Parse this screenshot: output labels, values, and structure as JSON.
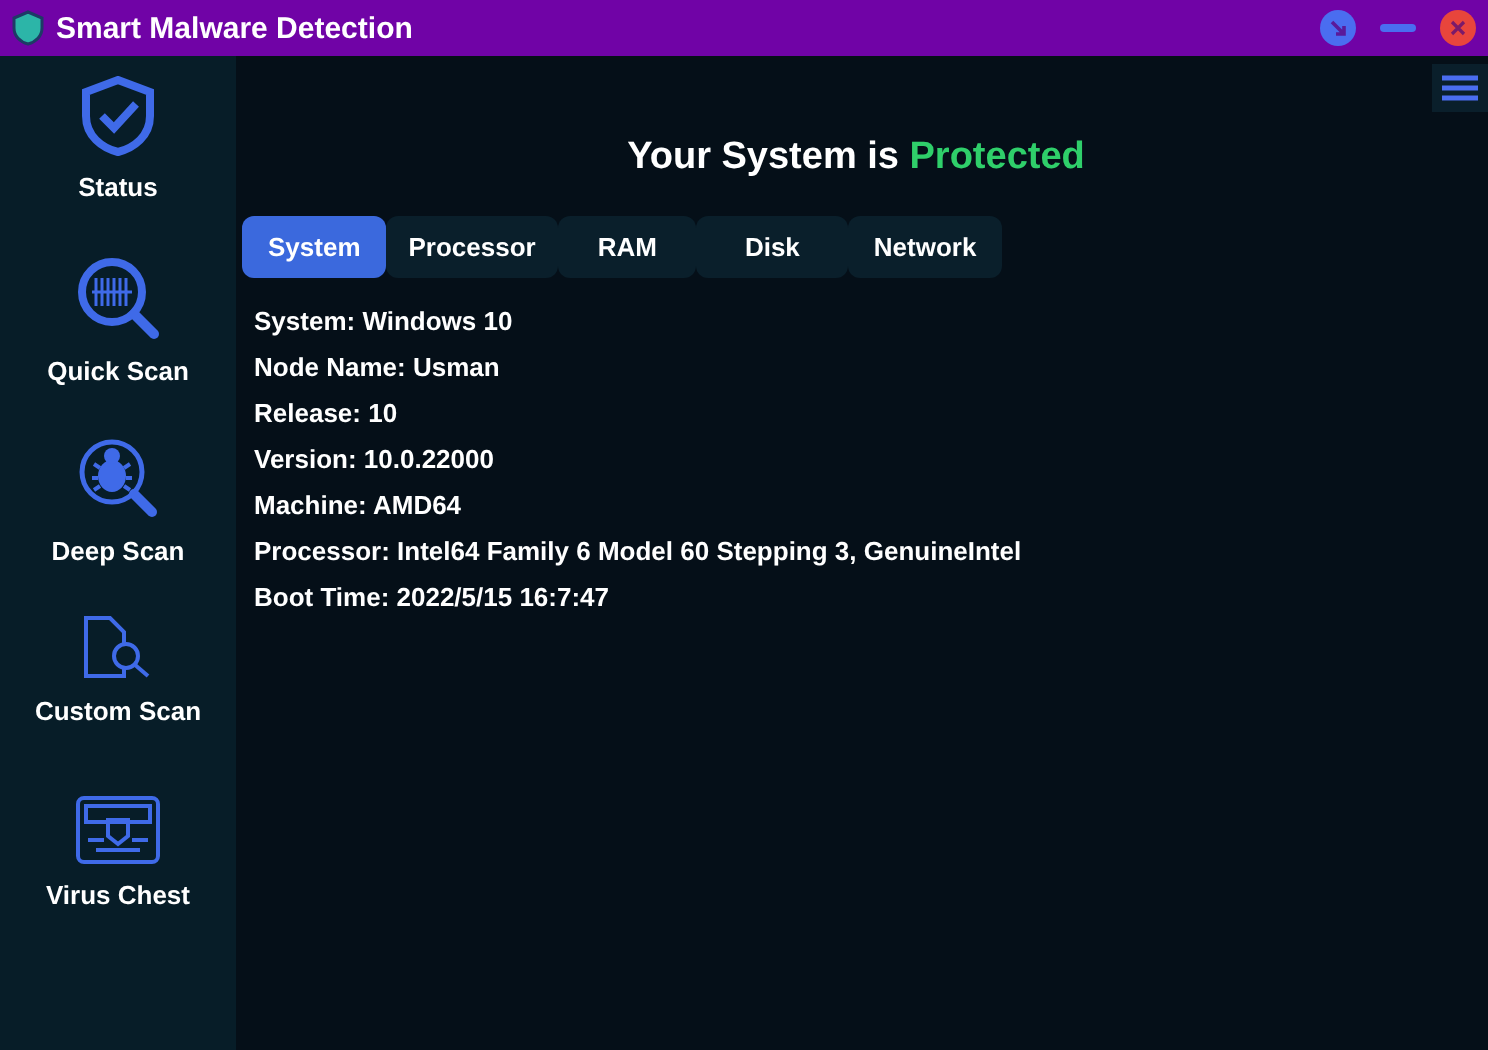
{
  "window": {
    "title": "Smart Malware Detection"
  },
  "sidebar": {
    "items": [
      {
        "label": "Status",
        "kind": "shield"
      },
      {
        "label": "Quick Scan",
        "kind": "quick"
      },
      {
        "label": "Deep Scan",
        "kind": "deep"
      },
      {
        "label": "Custom Scan",
        "kind": "custom"
      },
      {
        "label": "Virus Chest",
        "kind": "chest"
      }
    ]
  },
  "heading": {
    "text": "Your System is",
    "status": "Protected"
  },
  "tabs": [
    {
      "label": "System",
      "selected": true
    },
    {
      "label": "Processor",
      "selected": false
    },
    {
      "label": "RAM",
      "selected": false
    },
    {
      "label": "Disk",
      "selected": false
    },
    {
      "label": "Network",
      "selected": false
    }
  ],
  "info": [
    "System: Windows 10",
    "Node Name: Usman",
    "Release: 10",
    "Version: 10.0.22000",
    "Machine: AMD64",
    "Processor: Intel64 Family 6 Model 60 Stepping 3, GenuineIntel",
    "Boot Time: 2022/5/15 16:7:47"
  ]
}
